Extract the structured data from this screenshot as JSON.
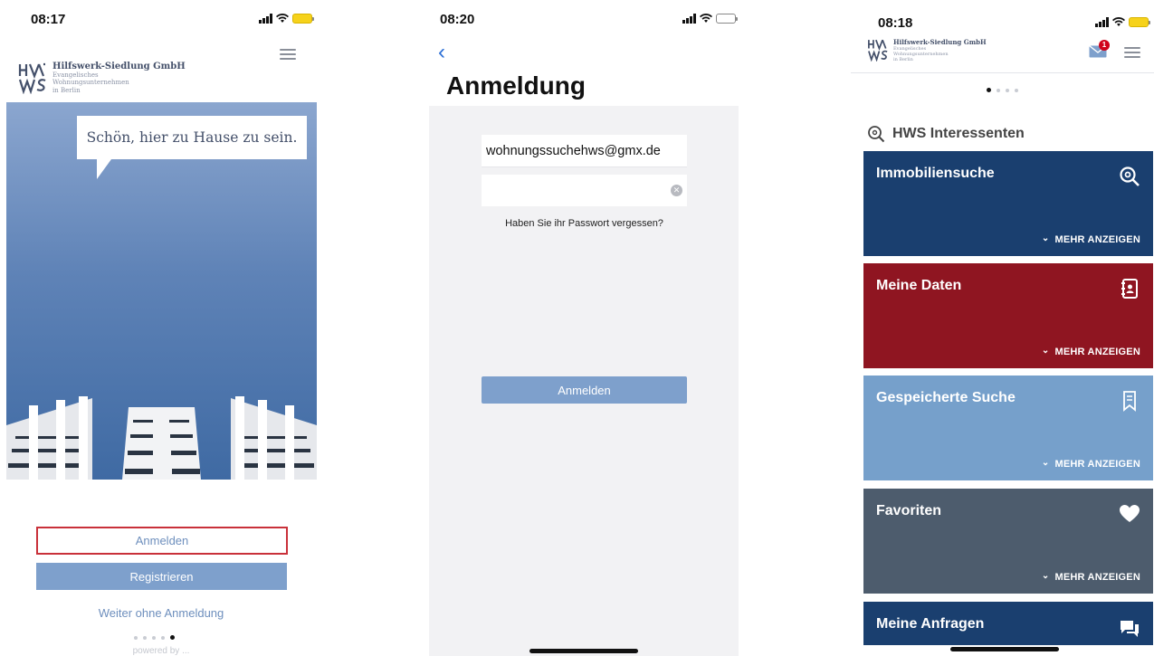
{
  "screen1": {
    "time": "08:17",
    "company_name": "Hilfswerk-Siedlung GmbH",
    "company_sub_lines": [
      "Evangelisches",
      "Wohnungsunternehmen",
      "in Berlin"
    ],
    "tagline": "Schön, hier zu Hause zu sein.",
    "login_label": "Anmelden",
    "register_label": "Registrieren",
    "skip_label": "Weiter ohne Anmeldung",
    "page_dots": {
      "count": 5,
      "active": 5
    },
    "powered_by": "powered by ...",
    "colors": {
      "accent_blue": "#7ea0cc",
      "highlight_red": "#c9313a"
    }
  },
  "screen2": {
    "time": "08:20",
    "title": "Anmeldung",
    "email_value": "wohnungssuchehws@gmx.de",
    "password_value": "",
    "forgot_label": "Haben Sie ihr Passwort vergessen?",
    "login_button": "Anmelden"
  },
  "screen3": {
    "time": "08:18",
    "company_name": "Hilfswerk-Siedlung GmbH",
    "company_sub_lines": [
      "Evangelisches",
      "Wohnungsunternehmen",
      "in Berlin"
    ],
    "mail_badge": "1",
    "page_dots": {
      "count": 4,
      "active": 1
    },
    "section_title": "HWS Interessenten",
    "tiles": [
      {
        "title": "Immobiliensuche",
        "more": "MEHR ANZEIGEN",
        "icon": "search-icon",
        "color": "#1a3f6f"
      },
      {
        "title": "Meine Daten",
        "more": "MEHR ANZEIGEN",
        "icon": "contacts-book-icon",
        "color": "#8f1521"
      },
      {
        "title": "Gespeicherte Suche",
        "more": "MEHR ANZEIGEN",
        "icon": "bookmark-icon",
        "color": "#76a0cb"
      },
      {
        "title": "Favoriten",
        "more": "MEHR ANZEIGEN",
        "icon": "heart-icon",
        "color": "#4d5c6d"
      },
      {
        "title": "Meine Anfragen",
        "more": "",
        "icon": "chat-icon",
        "color": "#1a3f6f"
      }
    ]
  }
}
